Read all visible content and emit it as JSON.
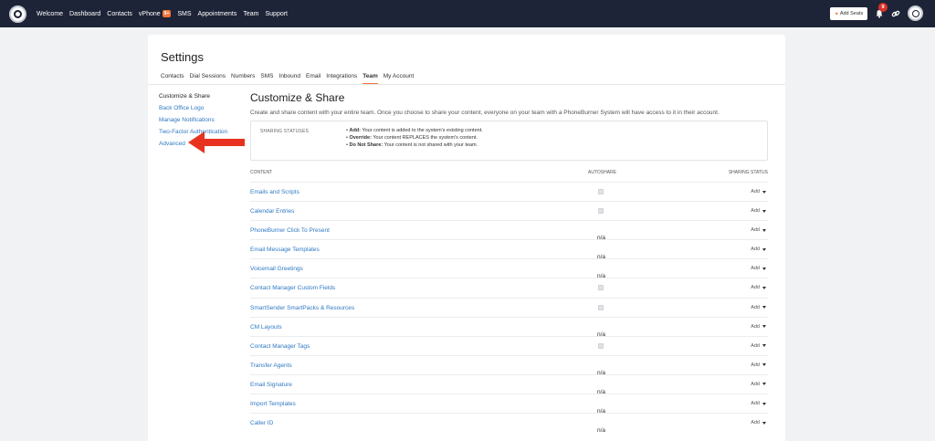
{
  "nav": {
    "links": [
      "Welcome",
      "Dashboard",
      "Contacts",
      "vPhone",
      "SMS",
      "Appointments",
      "Team",
      "Support"
    ],
    "vphone_badge": "9+",
    "add_seats": "Add Seats",
    "notifications_count": "9"
  },
  "page": {
    "title": "Settings",
    "tabs": [
      "Contacts",
      "Dial Sessions",
      "Numbers",
      "SMS",
      "Inbound",
      "Email",
      "Integrations",
      "Team",
      "My Account"
    ],
    "active_tab": "Team"
  },
  "side_menu": [
    "Customize & Share",
    "Back Office Logo",
    "Manage Notifications",
    "Two-Factor Authentication",
    "Advanced"
  ],
  "main": {
    "title": "Customize & Share",
    "description": "Create and share content with your entire team. Once you choose to share your content, everyone on your team with a PhoneBurner System will have access to it in their account.",
    "statuses": {
      "label": "SHARING STATUSES",
      "items": [
        {
          "term": "Add:",
          "text": "Your content is added to the system's existing content."
        },
        {
          "term": "Override:",
          "text": "Your content REPLACES the system's content."
        },
        {
          "term": "Do Not Share:",
          "text": "Your content is not shared with your team."
        }
      ]
    },
    "table": {
      "headers": {
        "content": "CONTENT",
        "autoshare": "AUTOSHARE",
        "status": "SHARING STATUS"
      },
      "rows": [
        {
          "name": "Emails and Scripts",
          "autoshare": "checkbox",
          "status": "Add"
        },
        {
          "name": "Calendar Entries",
          "autoshare": "checkbox",
          "status": "Add"
        },
        {
          "name": "PhoneBurner Click To Present",
          "autoshare": "n/a",
          "status": "Add"
        },
        {
          "name": "Email Message Templates",
          "autoshare": "n/a",
          "status": "Add"
        },
        {
          "name": "Voicemail Greetings",
          "autoshare": "n/a",
          "status": "Add"
        },
        {
          "name": "Contact Manager Custom Fields",
          "autoshare": "checkbox",
          "status": "Add"
        },
        {
          "name": "SmartSender SmartPacks & Resources",
          "autoshare": "checkbox",
          "status": "Add"
        },
        {
          "name": "CM Layouts",
          "autoshare": "n/a",
          "status": "Add"
        },
        {
          "name": "Contact Manager Tags",
          "autoshare": "checkbox",
          "status": "Add"
        },
        {
          "name": "Transfer Agents",
          "autoshare": "n/a",
          "status": "Add"
        },
        {
          "name": "Email Signature",
          "autoshare": "n/a",
          "status": "Add"
        },
        {
          "name": "Import Templates",
          "autoshare": "n/a",
          "status": "Add"
        },
        {
          "name": "Caller ID",
          "autoshare": "n/a",
          "status": "Add"
        }
      ]
    }
  },
  "colors": {
    "nav_bg": "#1e2437",
    "accent": "#f0773a",
    "link": "#2f79c3",
    "annotation_arrow": "#e8321f"
  },
  "icons": [
    "logo-icon",
    "star-icon",
    "bell-icon",
    "link-icon",
    "avatar-icon",
    "caret-down-icon",
    "red-arrow-annotation"
  ]
}
